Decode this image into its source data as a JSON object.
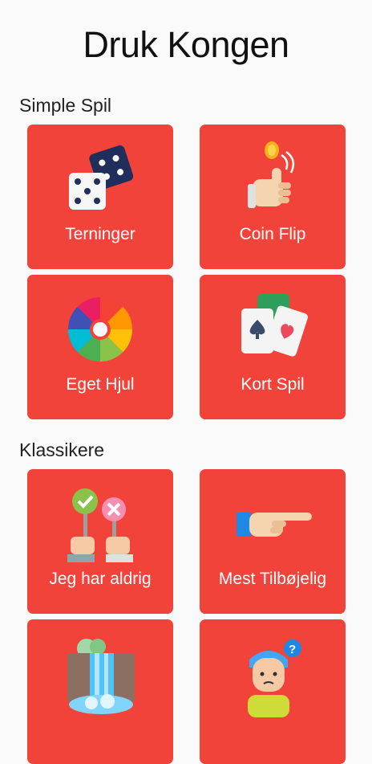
{
  "app_title": "Druk Kongen",
  "sections": [
    {
      "title": "Simple Spil"
    },
    {
      "title": "Klassikere"
    }
  ],
  "tiles": [
    {
      "label": "Terninger",
      "icon": "dice-icon"
    },
    {
      "label": "Coin Flip",
      "icon": "coin-flip-icon"
    },
    {
      "label": "Eget Hjul",
      "icon": "color-wheel-icon"
    },
    {
      "label": "Kort Spil",
      "icon": "playing-cards-icon"
    },
    {
      "label": "Jeg har aldrig",
      "icon": "yes-no-signs-icon"
    },
    {
      "label": "Mest Tilbøjelig",
      "icon": "pointing-hand-icon"
    },
    {
      "label": "",
      "icon": "waterfall-icon"
    },
    {
      "label": "",
      "icon": "confused-person-icon"
    }
  ],
  "colors": {
    "tile": "#f2433a",
    "background": "#fafafa"
  }
}
